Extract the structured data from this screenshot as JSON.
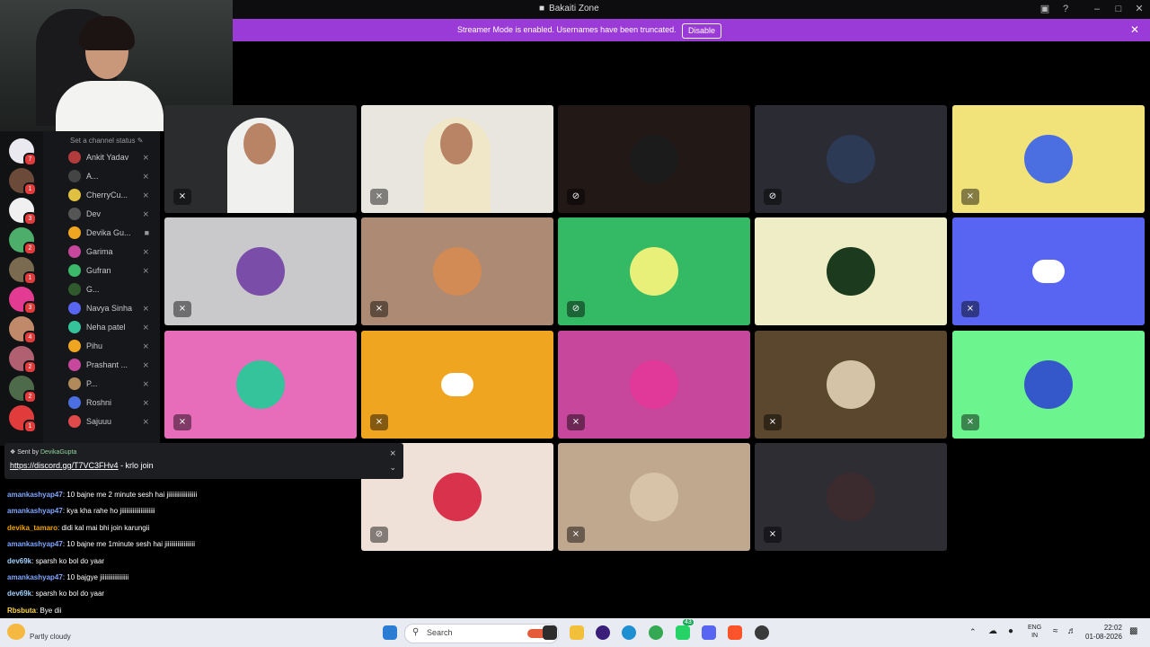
{
  "window": {
    "title": "Bakaiti Zone",
    "controls": [
      "inbox-icon",
      "help-icon",
      "minimize-icon",
      "maximize-icon",
      "close-icon"
    ]
  },
  "banner": {
    "text": "Streamer Mode is enabled. Usernames have been truncated.",
    "button": "Disable",
    "color": "#9b3bd7"
  },
  "channel": {
    "status_placeholder": "Set a channel status"
  },
  "members": [
    {
      "name": "Ankit Yadav",
      "icon": "mic-muted-icon"
    },
    {
      "name": "A...",
      "icon": "mic-muted-icon"
    },
    {
      "name": "CherryCu...",
      "icon": "mic-muted-icon"
    },
    {
      "name": "Dev",
      "icon": "mic-muted-icon"
    },
    {
      "name": "Devika Gu...",
      "icon": "video-icon"
    },
    {
      "name": "Garima",
      "icon": "mic-muted-icon"
    },
    {
      "name": "Gufran",
      "icon": "mic-muted-icon"
    },
    {
      "name": "G...",
      "icon": ""
    },
    {
      "name": "Navya Sinha",
      "icon": "mic-muted-icon"
    },
    {
      "name": "Neha patel",
      "icon": "mic-muted-icon"
    },
    {
      "name": "Pihu",
      "icon": "mic-muted-icon"
    },
    {
      "name": "Prashant ...",
      "icon": "mic-muted-icon"
    },
    {
      "name": "P...",
      "icon": "mic-muted-icon"
    },
    {
      "name": "Roshni",
      "icon": "mic-muted-icon"
    },
    {
      "name": "Sajuuu",
      "icon": "mic-muted-icon"
    }
  ],
  "servers": [
    {
      "badge": "7"
    },
    {
      "badge": "1"
    },
    {
      "badge": "3"
    },
    {
      "badge": "2"
    },
    {
      "badge": "1"
    },
    {
      "badge": "3"
    },
    {
      "badge": "4"
    },
    {
      "badge": "2"
    },
    {
      "badge": "2"
    },
    {
      "badge": "1"
    }
  ],
  "pinned": {
    "sent_by": "Sent by",
    "sender": "DevikaGupta",
    "link": "https://discord.gg/T7VC3FHv4",
    "suffix": " - krlo join"
  },
  "chat": [
    {
      "user": "amankashyap47",
      "msg": ": 10 bajne me 2 minute sesh hai jiiiiiiiiiiiiiiiiii",
      "color": "#7ea6ff"
    },
    {
      "user": "amankashyap47",
      "msg": ": kya kha rahe ho jiiiiiiiiiiiiiiiiiiiii",
      "color": "#7ea6ff"
    },
    {
      "user": "devika_tamaro",
      "msg": ": didi kal mai bhi join karungii",
      "color": "#f0a500"
    },
    {
      "user": "amankashyap47",
      "msg": ": 10 bajne me 1minute sesh hai jiiiiiiiiiiiiiiiiii",
      "color": "#7ea6ff"
    },
    {
      "user": "dev69k",
      "msg": ": sparsh ko bol do yaar",
      "color": "#9fd0ff"
    },
    {
      "user": "amankashyap47",
      "msg": ": 10 bajgye jiiiiiiiiiiiiiiiii",
      "color": "#7ea6ff"
    },
    {
      "user": "dev69k",
      "msg": ": sparsh ko bol do yaar",
      "color": "#9fd0ff"
    },
    {
      "user": "Rbsbuta",
      "msg": ": Bye dii",
      "color": "#ffd54f"
    }
  ],
  "tiles": [
    {
      "bg": "#2a2c2e",
      "avatar": "",
      "mute": "mic-muted-icon",
      "kind": "cam"
    },
    {
      "bg": "#e9e6e0",
      "avatar": "",
      "mute": "mic-muted-icon",
      "kind": "cam"
    },
    {
      "bg": "#221917",
      "avatar": "#1b1b1b",
      "mute": "mic-deafened-icon"
    },
    {
      "bg": "#2b2c33",
      "avatar": "#2d3a55",
      "mute": "mic-deafened-icon"
    },
    {
      "bg": "#f1e27a",
      "avatar": "#4b6fe0",
      "mute": "mic-muted-icon"
    },
    {
      "bg": "#c9c9cc",
      "avatar": "#7a4da8",
      "mute": "mic-muted-icon"
    },
    {
      "bg": "#ad8a74",
      "avatar": "#d28b55",
      "mute": "mic-muted-icon"
    },
    {
      "bg": "#34b965",
      "avatar": "#e9f07a",
      "mute": "mic-deafened-icon"
    },
    {
      "bg": "#eeedc6",
      "avatar": "#1c3b1e",
      "mute": ""
    },
    {
      "bg": "#5865f2",
      "avatar": "#5865f2",
      "mute": "mic-muted-icon",
      "discord": true
    },
    {
      "bg": "#e76cba",
      "avatar": "#35c39b",
      "mute": "mic-muted-icon"
    },
    {
      "bg": "#f0a521",
      "avatar": "#f0a521",
      "mute": "mic-muted-icon",
      "discord": true
    },
    {
      "bg": "#c6479c",
      "avatar": "#e0399a",
      "mute": "mic-muted-icon"
    },
    {
      "bg": "#5a472d",
      "avatar": "#d5c3a8",
      "mute": "mic-muted-icon"
    },
    {
      "bg": "#6cf48e",
      "avatar": "#3458c9",
      "mute": "mic-muted-icon"
    },
    {
      "bg": "#efe1d8",
      "avatar": "#d8324c",
      "mute": "mic-deafened-icon"
    },
    {
      "bg": "#bfa88e",
      "avatar": "#d7c3a7",
      "mute": "mic-muted-icon"
    },
    {
      "bg": "#2d2d33",
      "avatar": "#3b2a2e",
      "mute": "mic-muted-icon"
    }
  ],
  "taskbar": {
    "weather": "Partly cloudy",
    "search": "Search",
    "lang_top": "ENG",
    "lang_bottom": "IN",
    "time": "22:02",
    "date": "01-08-2026",
    "apps": [
      "windows-start-icon",
      "taskview-icon",
      "file-explorer-icon",
      "cortana-icon",
      "edge-icon",
      "chrome-icon",
      "whatsapp-icon",
      "discord-icon",
      "brave-icon",
      "app-icon"
    ],
    "whatsapp_badge": "43"
  }
}
